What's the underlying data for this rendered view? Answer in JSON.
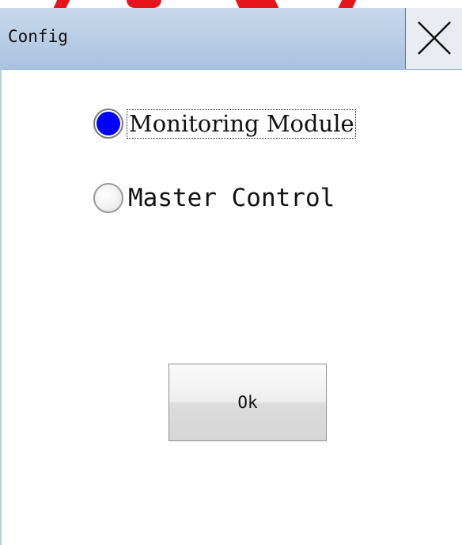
{
  "window": {
    "title": "Config",
    "close_icon": "close-icon"
  },
  "options": [
    {
      "label": "Monitoring Module",
      "selected": true
    },
    {
      "label": "Master Control",
      "selected": false
    }
  ],
  "actions": {
    "ok_label": "Ok"
  },
  "colors": {
    "titlebar": "#a9c2df",
    "radio_selected": "#0000ff",
    "accent_red": "#e8141c"
  }
}
